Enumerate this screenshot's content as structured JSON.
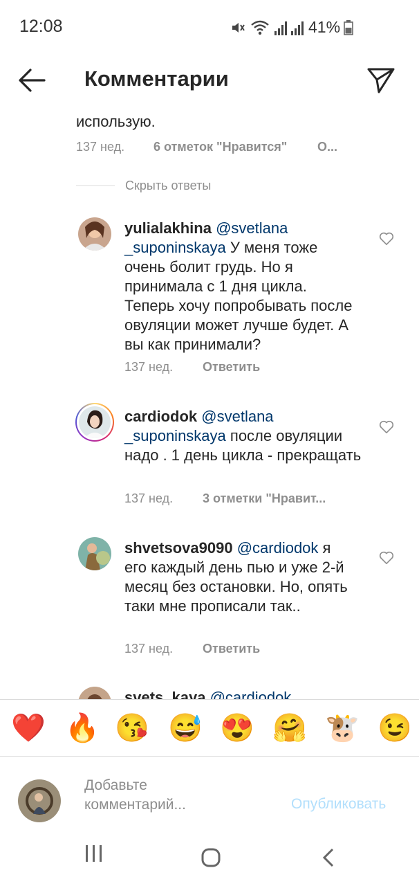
{
  "status_bar": {
    "time": "12:08",
    "battery": "41%"
  },
  "header": {
    "title": "Комментарии"
  },
  "prev_comment": {
    "text_tail": "использую.",
    "time": "137 нед.",
    "likes": "6 отметок \"Нравится\"",
    "more": "О..."
  },
  "hide_replies": "Скрыть ответы",
  "replies": [
    {
      "user": "yulialakhina",
      "mention": "@svetlana _suponinskaya",
      "text": "У меня тоже очень болит грудь.  Но я принимала с 1 дня цикла. Теперь хочу попробывать после овуляции может лучше будет. А вы как принимали?",
      "time": "137 нед.",
      "action": "Ответить"
    },
    {
      "user": "cardiodok",
      "mention": "@svetlana _suponinskaya",
      "text": "после овуляции надо . 1 день цикла - прекращать",
      "time": "137 нед.",
      "action": "3 отметки \"Нравит..."
    },
    {
      "user": "shvetsova9090",
      "mention": "@cardiodok",
      "text": "я его каждый день пью и уже 2-й месяц без остановки. Но, опять таки мне прописали так..",
      "time": "137 нед.",
      "action": "Ответить"
    },
    {
      "user": "svets_kaya",
      "mention": "@cardiodok"
    }
  ],
  "emoji_bar": [
    "❤️",
    "🔥",
    "😘",
    "😅",
    "😍",
    "🤗",
    "🐮",
    "😉"
  ],
  "comment_input": {
    "placeholder_line1": "Добавьте",
    "placeholder_line2": "комментарий...",
    "publish": "Опубликовать"
  },
  "colors": {
    "mention": "#00376b",
    "meta": "#8e8e8e",
    "publish": "#b2dffc"
  }
}
